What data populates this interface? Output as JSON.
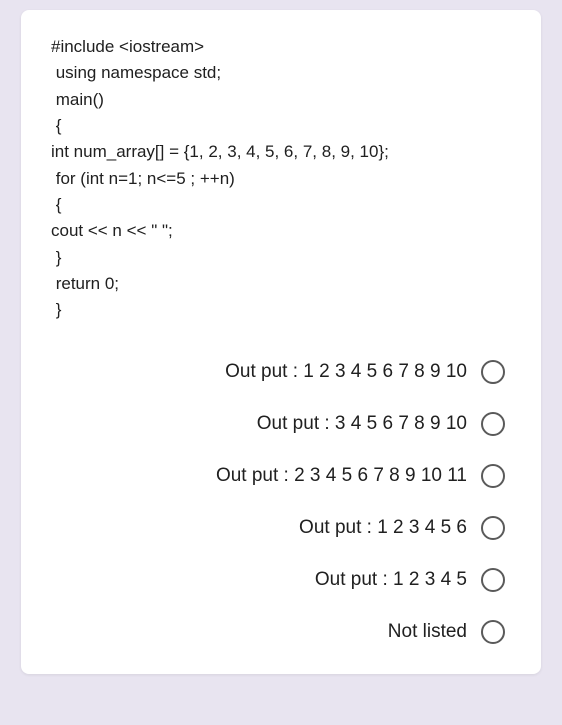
{
  "code": {
    "line1": "#include <iostream>",
    "line2": " using namespace std;",
    "line3": " main()",
    "line4": " {",
    "line5": "int num_array[] = {1, 2, 3, 4, 5, 6, 7, 8, 9, 10};",
    "line6": " for (int n=1; n<=5 ; ++n)",
    "line7": " {",
    "line8": "cout << n << \" \";",
    "line9": " }",
    "line10": " return 0;",
    "line11": " }"
  },
  "options": [
    {
      "label": "Out put : 1 2 3 4 5 6 7 8 9 10"
    },
    {
      "label": "Out put : 3 4 5 6 7 8 9 10"
    },
    {
      "label": "Out put : 2 3 4 5 6 7 8 9 10 11"
    },
    {
      "label": "Out put : 1 2 3 4 5 6"
    },
    {
      "label": "Out put : 1 2 3 4 5"
    },
    {
      "label": "Not listed"
    }
  ]
}
